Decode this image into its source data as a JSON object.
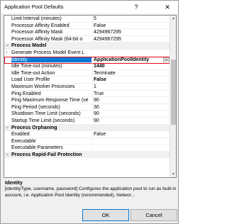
{
  "window": {
    "title": "Application Pool Defaults",
    "help_label": "?",
    "close_label": "✕"
  },
  "grid": {
    "rows": [
      {
        "type": "prop",
        "name": "Limit Interval (minutes)",
        "value": "5"
      },
      {
        "type": "prop",
        "name": "Processor Affinity Enabled",
        "value": "False"
      },
      {
        "type": "prop",
        "name": "Processor Affinity Mask",
        "value": "4294967295"
      },
      {
        "type": "prop",
        "name": "Processor Affinity Mask (64-bit o",
        "value": "4294967295"
      },
      {
        "type": "cat",
        "name": "Process Model"
      },
      {
        "type": "prop",
        "name": "Generate Process Model Event L",
        "value": "",
        "expand": "›"
      },
      {
        "type": "prop",
        "name": "Identity",
        "value": "ApplicationPoolIdentity",
        "selected": true,
        "bold": true,
        "ellipsis": "..."
      },
      {
        "type": "prop",
        "name": "Idle Time-out (minutes)",
        "value": "1440",
        "bold": true
      },
      {
        "type": "prop",
        "name": "Idle Time-out Action",
        "value": "Terminate"
      },
      {
        "type": "prop",
        "name": "Load User Profile",
        "value": "False",
        "bold": true
      },
      {
        "type": "prop",
        "name": "Maximum Worker Processes",
        "value": "1"
      },
      {
        "type": "prop",
        "name": "Ping Enabled",
        "value": "True"
      },
      {
        "type": "prop",
        "name": "Ping Maximum Response Time (se",
        "value": "90"
      },
      {
        "type": "prop",
        "name": "Ping Period (seconds)",
        "value": "30"
      },
      {
        "type": "prop",
        "name": "Shutdown Time Limit (seconds)",
        "value": "90"
      },
      {
        "type": "prop",
        "name": "Startup Time Limit (seconds)",
        "value": "90"
      },
      {
        "type": "cat",
        "name": "Process Orphaning"
      },
      {
        "type": "prop",
        "name": "Enabled",
        "value": "False"
      },
      {
        "type": "prop",
        "name": "Executable",
        "value": ""
      },
      {
        "type": "prop",
        "name": "Executable Parameters",
        "value": ""
      },
      {
        "type": "cat",
        "name": "Process Rapid-Fail Protection"
      }
    ]
  },
  "description": {
    "title": "Identity",
    "text": "[identityType, username, password] Configures the application pool to run as built-in account, i.e. Application Pool Identity (recommended), Networ..."
  },
  "buttons": {
    "ok": "OK",
    "cancel": "Cancel"
  },
  "colors": {
    "selection": "#0078d7",
    "highlight_border": "#e81123"
  }
}
